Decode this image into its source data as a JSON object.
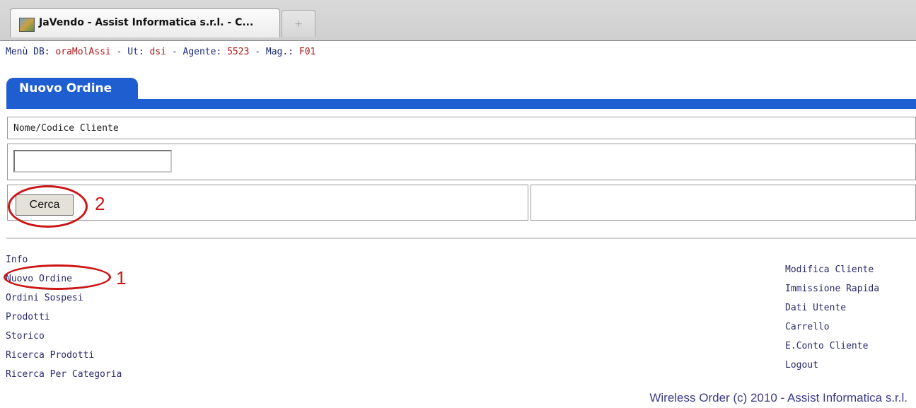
{
  "browser": {
    "tab_title": "JaVendo - Assist Informatica s.r.l. - C...",
    "new_tab_glyph": "+"
  },
  "header": {
    "menu_label": "Menù DB: ",
    "db_value": "oraMolAssi",
    "ut_label": " - Ut: ",
    "ut_value": "dsi",
    "agente_label": "  - Agente: ",
    "agente_value": "5523",
    "mag_label": "  - Mag.: ",
    "mag_value": "F01"
  },
  "form": {
    "tab_title": "Nuovo Ordine",
    "field_label": "Nome/Codice Cliente",
    "field_value": "",
    "search_button": "Cerca"
  },
  "annotations": {
    "marker_1": "1",
    "marker_2": "2"
  },
  "nav_left": [
    {
      "label": "Info"
    },
    {
      "label": "Nuovo Ordine"
    },
    {
      "label": "Ordini Sospesi"
    },
    {
      "label": "Prodotti"
    },
    {
      "label": "Storico"
    },
    {
      "label": "Ricerca Prodotti"
    },
    {
      "label": "Ricerca Per Categoria"
    }
  ],
  "nav_right": [
    {
      "label": "Modifica Cliente"
    },
    {
      "label": "Immissione Rapida"
    },
    {
      "label": "Dati Utente"
    },
    {
      "label": "Carrello"
    },
    {
      "label": "E.Conto Cliente"
    },
    {
      "label": "Logout"
    }
  ],
  "footer": "Wireless Order (c) 2010 - Assist Informatica s.r.l.",
  "colors": {
    "accent": "#1e5ed0",
    "value_red": "#b01818",
    "annotation_red": "#cc1515",
    "link": "#2a2a6e"
  }
}
